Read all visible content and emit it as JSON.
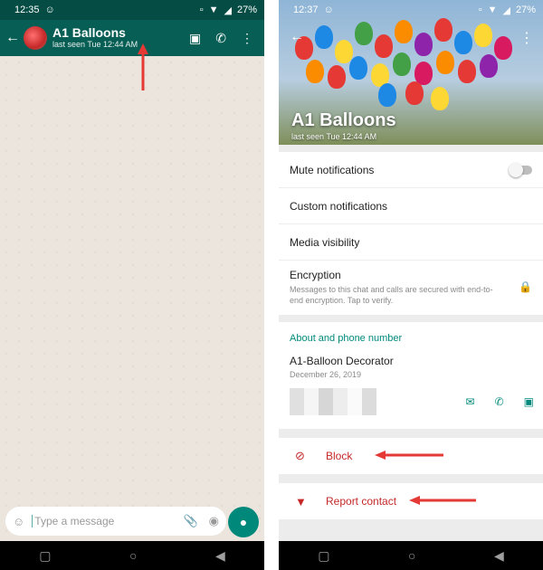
{
  "left": {
    "status": {
      "time": "12:35",
      "battery": "27%"
    },
    "chat": {
      "name": "A1 Balloons",
      "last_seen": "last seen Tue 12:44 AM"
    },
    "composer": {
      "placeholder": "Type a message"
    }
  },
  "right": {
    "status": {
      "time": "12:37",
      "battery": "27%"
    },
    "contact": {
      "name": "A1 Balloons",
      "last_seen": "last seen Tue 12:44 AM"
    },
    "settings": {
      "mute": "Mute notifications",
      "custom": "Custom notifications",
      "media": "Media visibility",
      "encryption": "Encryption",
      "encryption_desc": "Messages to this chat and calls are secured with end-to-end encryption. Tap to verify."
    },
    "about": {
      "section_title": "About and phone number",
      "name": "A1-Balloon Decorator",
      "date": "December 26, 2019"
    },
    "actions": {
      "block": "Block",
      "report": "Report contact"
    }
  },
  "colors": {
    "header": "#075e54",
    "accent": "#00897b",
    "danger": "#c62828",
    "arrow": "#e53935"
  },
  "icons": [
    "back-arrow-icon",
    "video-call-icon",
    "phone-icon",
    "more-icon",
    "emoji-icon",
    "attach-icon",
    "camera-icon",
    "mic-icon",
    "lock-icon",
    "message-icon",
    "block-icon",
    "thumbs-down-icon"
  ]
}
